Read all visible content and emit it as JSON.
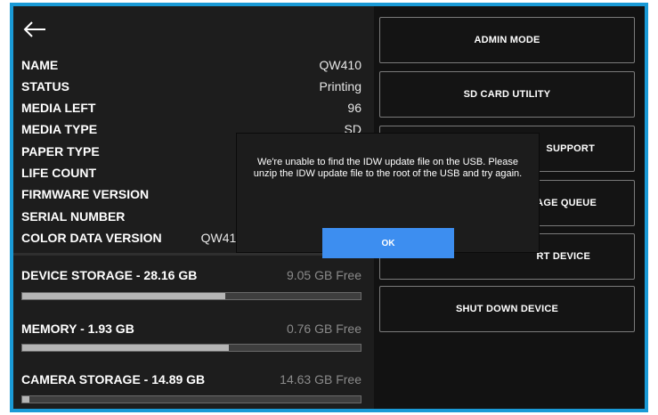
{
  "colors": {
    "frame_border": "#1a9ad6",
    "background": "#1d1d1d",
    "ok_button": "#3d8ef0",
    "bar_fill": "#b5b5b5"
  },
  "header": {
    "back_icon": "back-arrow-icon"
  },
  "info": [
    {
      "label": "NAME",
      "value": "QW410"
    },
    {
      "label": "STATUS",
      "value": "Printing"
    },
    {
      "label": "MEDIA LEFT",
      "value": "96"
    },
    {
      "label": "MEDIA TYPE",
      "value": "SD"
    },
    {
      "label": "PAPER TYPE",
      "value": ""
    },
    {
      "label": "LIFE COUNT",
      "value": ""
    },
    {
      "label": "FIRMWARE VERSION",
      "value": ""
    },
    {
      "label": "SERIAL NUMBER",
      "value": ""
    },
    {
      "label": "COLOR DATA VERSION",
      "value": "QW41("
    }
  ],
  "storage": [
    {
      "label": "DEVICE STORAGE - 28.16 GB",
      "free": "9.05 GB Free",
      "used_fraction": 0.6
    },
    {
      "label": "MEMORY - 1.93 GB",
      "free": "0.76 GB Free",
      "used_fraction": 0.61
    },
    {
      "label": "CAMERA STORAGE - 14.89 GB",
      "free": "14.63 GB Free",
      "used_fraction": 0.02
    }
  ],
  "actions": [
    {
      "label": "ADMIN MODE"
    },
    {
      "label": "SD CARD UTILITY"
    },
    {
      "label": "SUPPORT"
    },
    {
      "label": "IAGE QUEUE"
    },
    {
      "label": "RT DEVICE"
    },
    {
      "label": "SHUT DOWN DEVICE"
    }
  ],
  "dialog": {
    "message": "We're unable to find the IDW update file on the USB. Please unzip the IDW update file to the root of the USB and try again.",
    "ok_label": "OK"
  }
}
